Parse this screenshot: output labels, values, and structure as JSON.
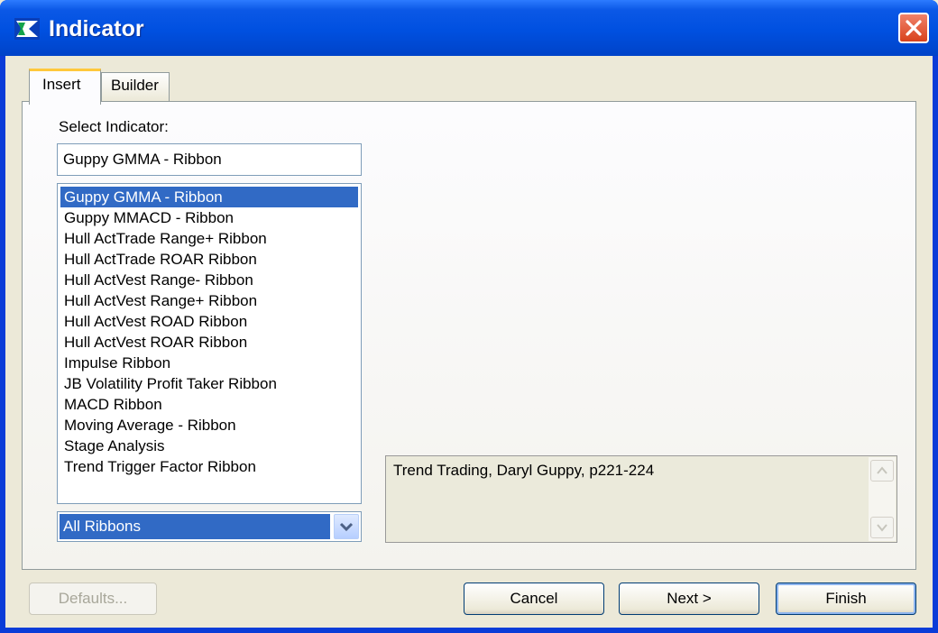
{
  "window": {
    "title": "Indicator"
  },
  "tabs": [
    {
      "label": "Insert",
      "active": true
    },
    {
      "label": "Builder",
      "active": false
    }
  ],
  "insert": {
    "select_label": "Select Indicator:",
    "search_value": "Guppy GMMA - Ribbon",
    "indicators": [
      "Guppy GMMA - Ribbon",
      "Guppy MMACD - Ribbon",
      "Hull ActTrade Range+ Ribbon",
      "Hull ActTrade ROAR Ribbon",
      "Hull ActVest Range- Ribbon",
      "Hull ActVest Range+ Ribbon",
      "Hull ActVest ROAD Ribbon",
      "Hull ActVest ROAR Ribbon",
      "Impulse Ribbon",
      "JB Volatility Profit Taker Ribbon",
      "MACD Ribbon",
      "Moving Average - Ribbon",
      "Stage Analysis",
      "Trend Trigger Factor Ribbon"
    ],
    "selected_index": 0,
    "category_value": "All Ribbons",
    "description": "Trend Trading, Daryl Guppy, p221-224"
  },
  "buttons": {
    "defaults": "Defaults...",
    "cancel": "Cancel",
    "next": "Next >",
    "finish": "Finish"
  },
  "colors": {
    "selection": "#316ac5",
    "titlebar": "#0050e0",
    "close": "#d8421c"
  }
}
